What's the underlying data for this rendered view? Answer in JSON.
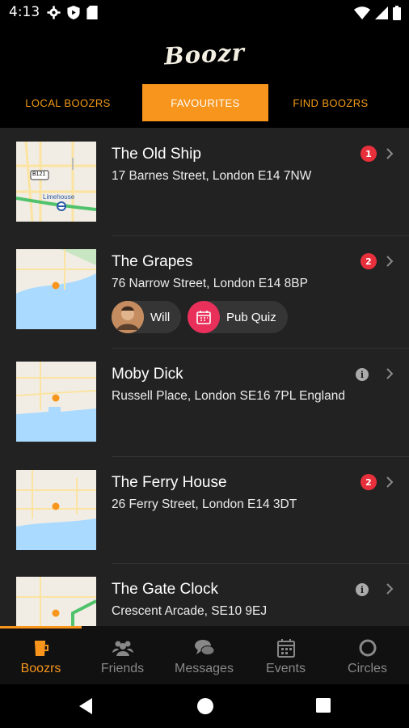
{
  "status_bar": {
    "time": "4:13"
  },
  "app": {
    "logo_text": "Boozr"
  },
  "tabs": [
    {
      "label": "LOCAL BOOZRS"
    },
    {
      "label": "FAVOURITES"
    },
    {
      "label": "FIND BOOZRS"
    }
  ],
  "pubs": [
    {
      "name": "The Old Ship",
      "address": "17 Barnes Street, London E14 7NW",
      "badge": "1",
      "map_labels": [
        "B121",
        "Limehouse"
      ]
    },
    {
      "name": "The Grapes",
      "address": "76 Narrow Street, London E14 8BP",
      "badge": "2",
      "chips": [
        {
          "label": "Will",
          "type": "friend"
        },
        {
          "label": "Pub Quiz",
          "type": "event"
        }
      ]
    },
    {
      "name": "Moby Dick",
      "address": "Russell Place, London SE16 7PL England",
      "info": "i"
    },
    {
      "name": "The Ferry House",
      "address": "26 Ferry Street, London E14 3DT",
      "badge": "2"
    },
    {
      "name": "The Gate Clock",
      "address": "Crescent Arcade, SE10 9EJ",
      "info": "i"
    }
  ],
  "bottom_nav": [
    {
      "label": "Boozrs",
      "icon": "pint-icon"
    },
    {
      "label": "Friends",
      "icon": "friends-icon"
    },
    {
      "label": "Messages",
      "icon": "chat-bubbles-icon"
    },
    {
      "label": "Events",
      "icon": "calendar-icon"
    },
    {
      "label": "Circles",
      "icon": "circle-icon"
    }
  ],
  "colors": {
    "accent": "#f7951d",
    "badge": "#e8303c",
    "event_chip": "#e8305a",
    "background": "#222222"
  }
}
